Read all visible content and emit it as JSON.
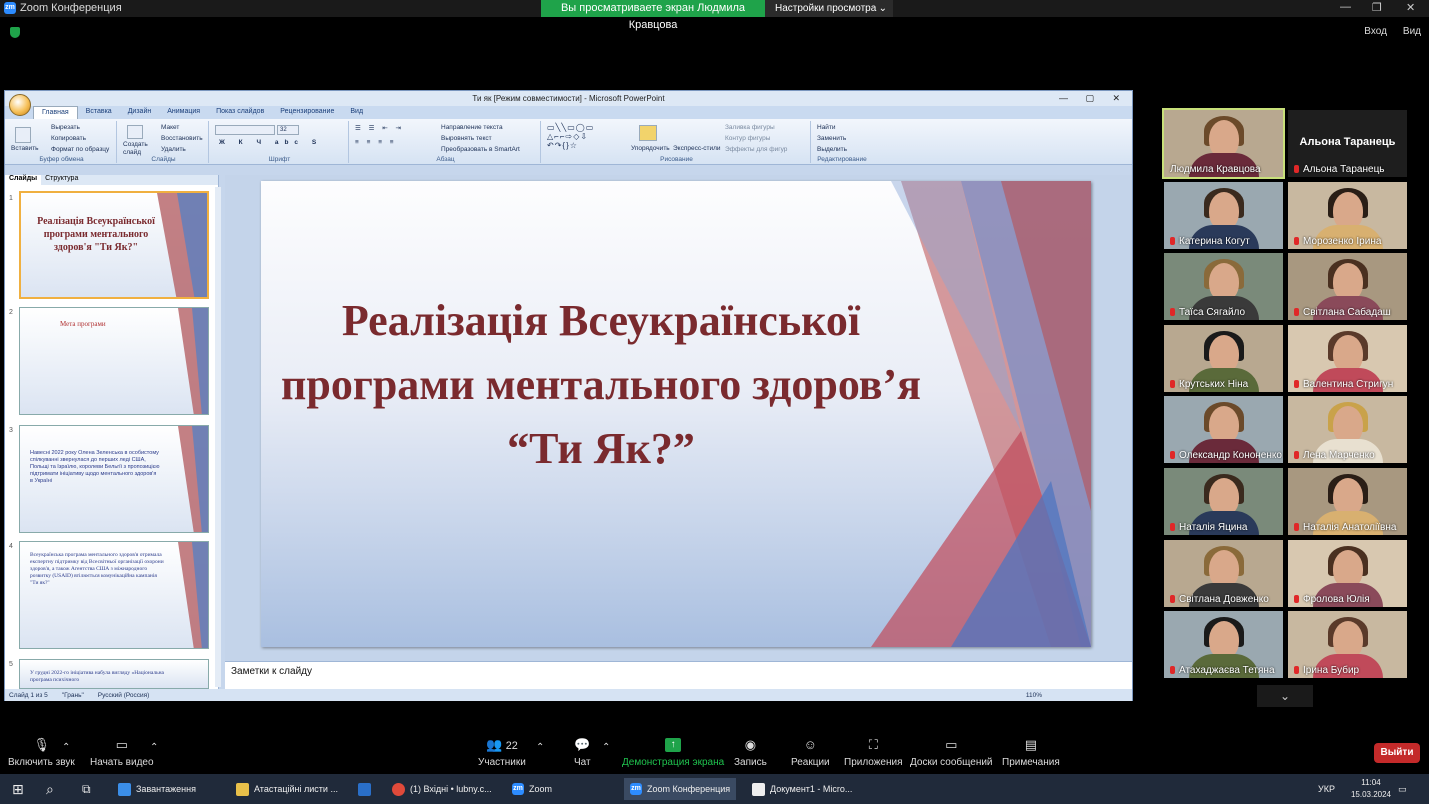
{
  "window": {
    "app_title": "Zoom Конференция",
    "share_banner": "Вы просматриваете экран Людмила Кравцова",
    "view_options": "Настройки просмотра",
    "enter": "Вход",
    "view": "Вид"
  },
  "ppt": {
    "title": "Ти як [Режим совместимости] - Microsoft PowerPoint",
    "tabs": [
      "Главная",
      "Вставка",
      "Дизайн",
      "Анимация",
      "Показ слайдов",
      "Рецензирование",
      "Вид"
    ],
    "ribbon": {
      "paste": "Вставить",
      "cut": "Вырезать",
      "copy": "Копировать",
      "format_painter": "Формат по образцу",
      "clipboard": "Буфер обмена",
      "create_slide": "Создать слайд",
      "layout": "Макет",
      "reset": "Восстановить",
      "delete": "Удалить",
      "slides": "Слайды",
      "font_size": "32",
      "font_group": "Шрифт",
      "paragraph_group": "Абзац",
      "text_direction": "Направление текста",
      "align_text": "Выровнять текст",
      "smartart": "Преобразовать в SmartArt",
      "arrange": "Упорядочить",
      "quick_styles": "Экспресс-стили",
      "shape_fill": "Заливка фигуры",
      "shape_outline": "Контур фигуры",
      "shape_effects": "Эффекты для фигур",
      "drawing_group": "Рисование",
      "find": "Найти",
      "replace": "Заменить",
      "select": "Выделить",
      "editing_group": "Редактирование"
    },
    "panel_tabs": [
      "Слайды",
      "Структура"
    ],
    "slides": [
      {
        "num": "1",
        "text": "Реалізація Всеукраїнської програми ментального здоров'я \"Ти Як?\""
      },
      {
        "num": "2",
        "text": "Мета програми"
      },
      {
        "num": "3",
        "text": "Навесні 2022 року Олена Зеленська в особистому спілкуванні звернулася до перших леді США, Польщі та Ізраїлю, королеви Бельгії з пропозицією підтримати ініціативу щодо ментального здоров'я в Україні"
      },
      {
        "num": "4",
        "text": "Всеукраїнська програма ментального здоров'я отримала експертну підтримку від Всесвітньої організації охорони здоров'я, а також Агентства США з міжнародного розвитку (USAID) втілюється комунікаційна кампанія \"Ти як?\""
      },
      {
        "num": "5",
        "text": "У грудні 2022-го ініціатива набула вигляду «Національна програма психічного"
      }
    ],
    "slide_title": "Реалізація Всеукраїнської програми ментального здоров’я “Ти Як?”",
    "notes": "Заметки к слайду",
    "status": {
      "slide": "Слайд 1 из 5",
      "theme": "\"Грань\"",
      "lang": "Русский (Россия)",
      "zoom": "110%"
    }
  },
  "participants": [
    {
      "name": "Людмила Кравцова",
      "active": true
    },
    {
      "name": "Альона Таранець",
      "active": false
    },
    {
      "name": "Катерина Когут"
    },
    {
      "name": "Морозенко Ірина"
    },
    {
      "name": "Таїса Сягайло"
    },
    {
      "name": "Світлана Сабадаш"
    },
    {
      "name": "Крутських Ніна"
    },
    {
      "name": "Валентина Стригун"
    },
    {
      "name": "Олександр Кононенко"
    },
    {
      "name": "Лена Марченко"
    },
    {
      "name": "Наталія Яцина"
    },
    {
      "name": "Наталія Анатоліївна"
    },
    {
      "name": "Світлана Довженко"
    },
    {
      "name": "Фролова Юлія"
    },
    {
      "name": "Атахаджаєва Тетяна"
    },
    {
      "name": "Ірина Бубир"
    }
  ],
  "toolbar": {
    "unmute": "Включить звук",
    "start_video": "Начать видео",
    "participants": "Участники",
    "participants_count": "22",
    "chat": "Чат",
    "share": "Демонстрация экрана",
    "record": "Запись",
    "reactions": "Реакции",
    "apps": "Приложения",
    "whiteboards": "Доски сообщений",
    "notes": "Примечания",
    "leave": "Выйти"
  },
  "taskbar": {
    "items": [
      "Завантаження",
      "Атастаційні листи ...",
      "(1) Вхідні • lubny.c...",
      "Zoom",
      "Zoom Конференция",
      "Документ1 - Micro..."
    ],
    "lang": "УКР",
    "time": "11:04",
    "date": "15.03.2024"
  }
}
